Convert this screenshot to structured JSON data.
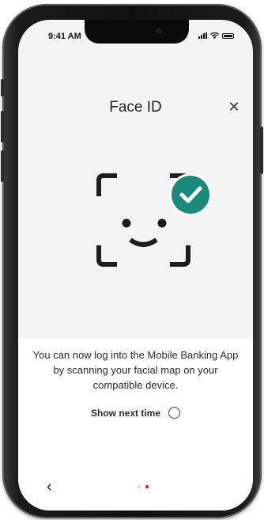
{
  "status_bar": {
    "time": "9:41 AM"
  },
  "header": {
    "title": "Face ID",
    "close_icon": "close-icon"
  },
  "illustration": {
    "icon": "face-id-icon",
    "badge_icon": "check-circle-icon",
    "badge_color": "#1a8a7a"
  },
  "body": {
    "description": "You can now log into the Mobile Banking App by scanning your facial map on your compatible device.",
    "show_next_time_label": "Show next time",
    "show_next_time_checked": false
  },
  "footer": {
    "back_icon": "chevron-left-icon",
    "pages": 2,
    "active_page": 2,
    "active_dot_color": "#e3142f"
  }
}
